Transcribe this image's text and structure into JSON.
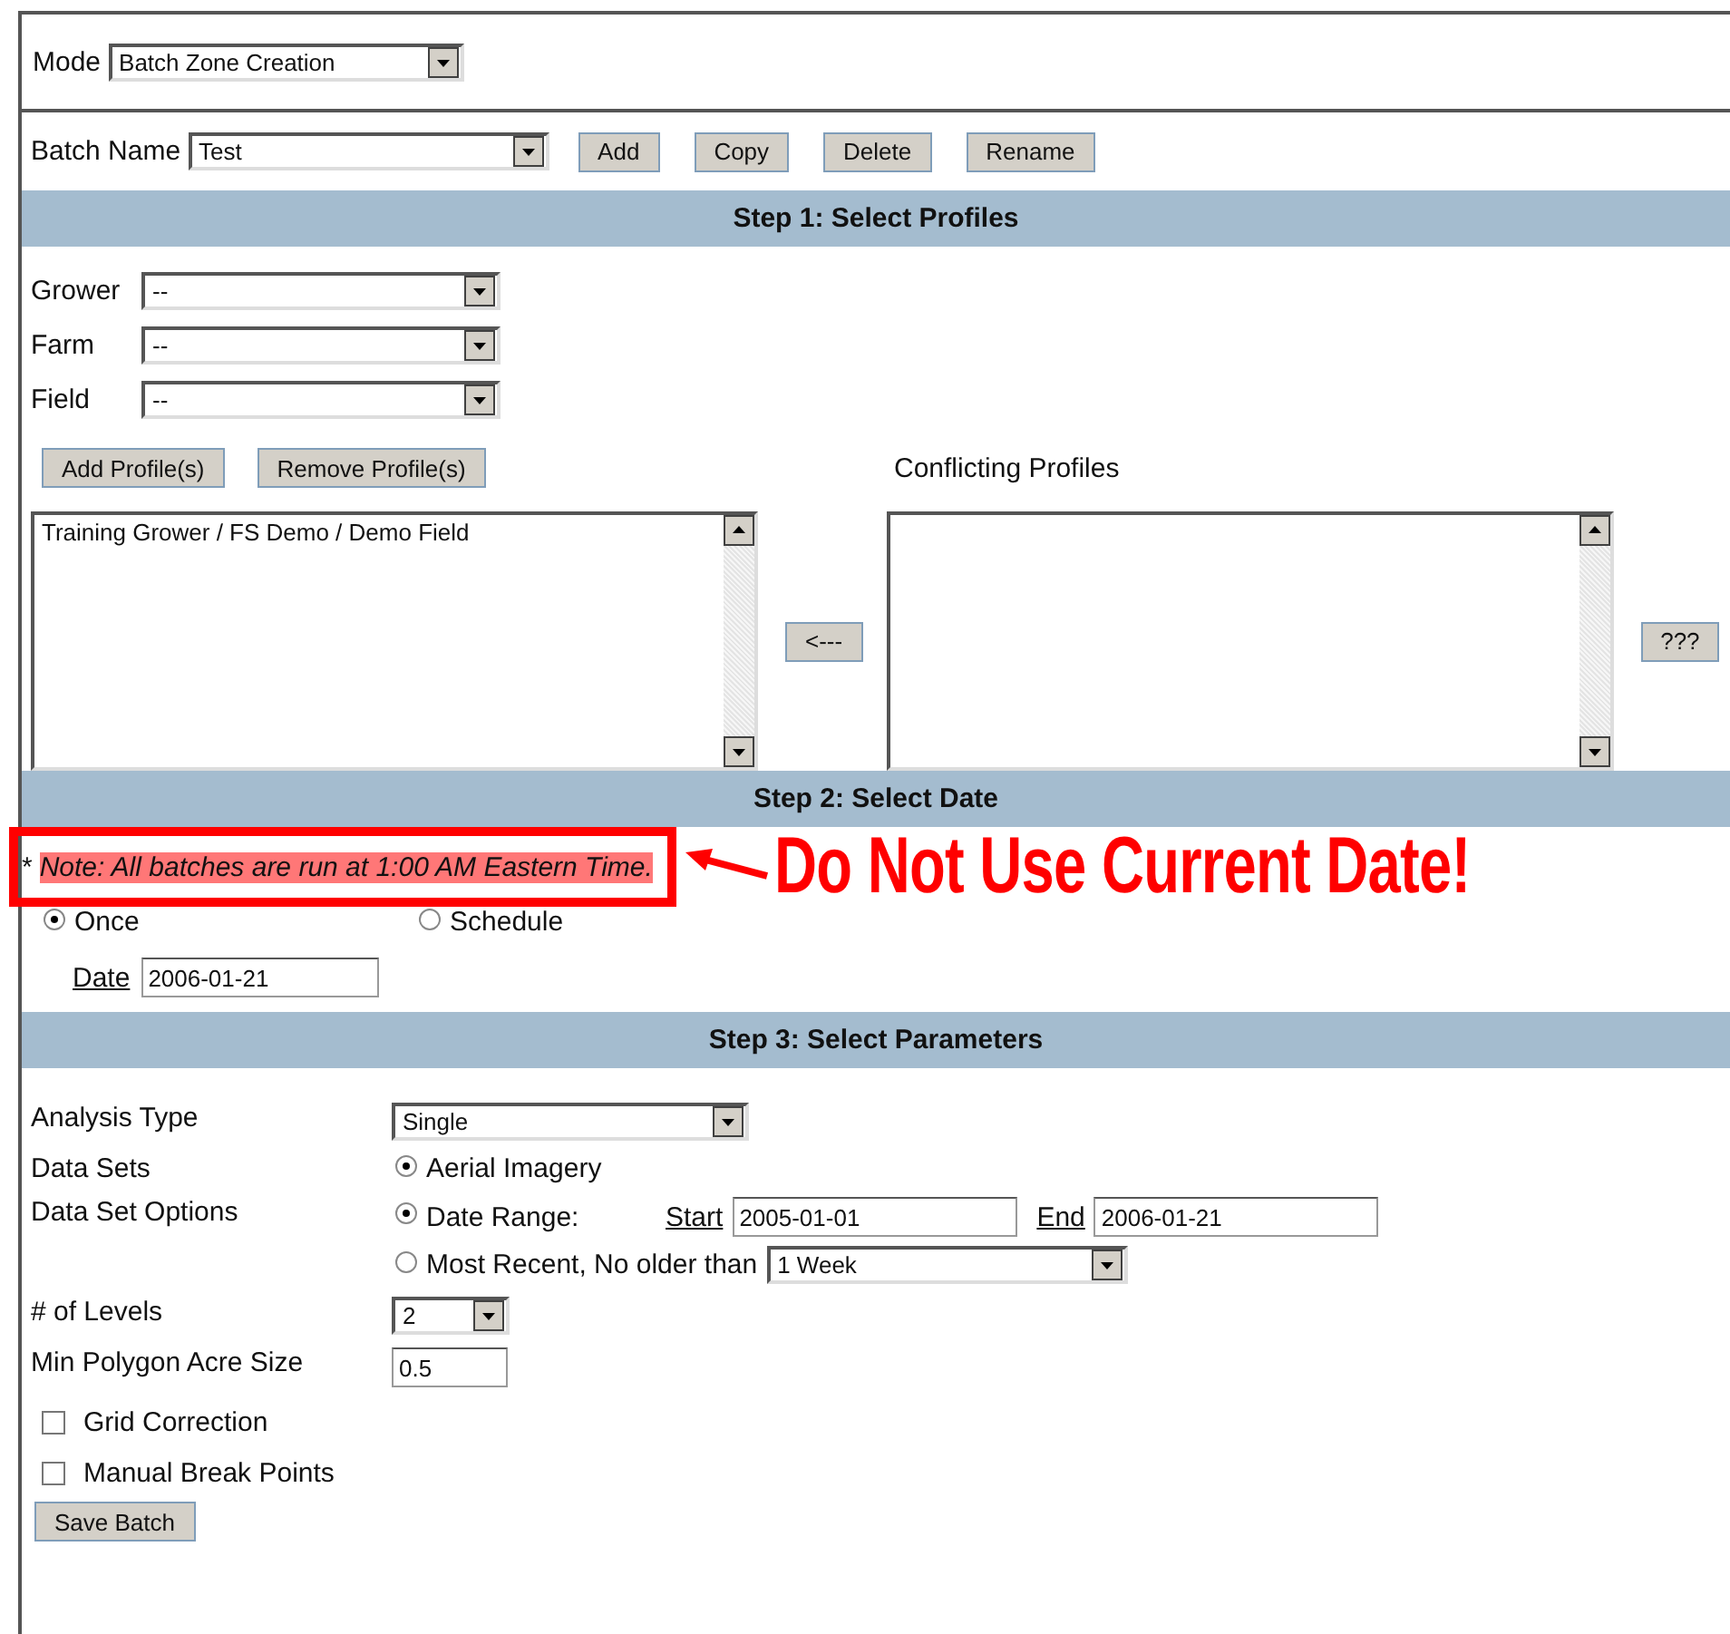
{
  "mode": {
    "label": "Mode",
    "value": "Batch Zone Creation"
  },
  "batch": {
    "label": "Batch Name",
    "value": "Test",
    "buttons": [
      "Add",
      "Copy",
      "Delete",
      "Rename"
    ]
  },
  "step1": {
    "title": "Step 1: Select Profiles",
    "selectors": [
      {
        "label": "Grower",
        "value": "--"
      },
      {
        "label": "Farm",
        "value": "--"
      },
      {
        "label": "Field",
        "value": "--"
      }
    ],
    "buttons": [
      "Add Profile(s)",
      "Remove Profile(s)"
    ],
    "conflicting_title": "Conflicting Profiles",
    "profiles": [
      "Training Grower / FS Demo / Demo Field"
    ],
    "move_button": "<---",
    "conflict_button": "???"
  },
  "step2": {
    "title": "Step 2: Select Date",
    "note_mark": "*",
    "note": "Note: All batches are run at 1:00 AM Eastern Time.",
    "annotation": "Do Not Use Current Date!",
    "frequency": [
      {
        "label": "Once",
        "selected": true
      },
      {
        "label": "Schedule",
        "selected": false
      }
    ],
    "date": {
      "label": "Date",
      "value": "2006-01-21"
    }
  },
  "step3": {
    "title": "Step 3: Select Parameters",
    "analysis_type": {
      "label": "Analysis Type",
      "value": "Single"
    },
    "data_sets": {
      "label": "Data Sets",
      "options": [
        {
          "label": "Aerial Imagery",
          "selected": true
        }
      ]
    },
    "data_set_options": {
      "label": "Data Set Options",
      "options": [
        {
          "kind": "range",
          "label": "Date Range:",
          "selected": true,
          "start_label": "Start",
          "start": "2005-01-01",
          "end_label": "End",
          "end": "2006-01-21"
        },
        {
          "kind": "recent",
          "label": "Most Recent, No older than",
          "selected": false,
          "value": "1 Week"
        }
      ]
    },
    "levels": {
      "label": "# of Levels",
      "value": "2"
    },
    "min_polygon": {
      "label": "Min Polygon Acre Size",
      "value": "0.5"
    },
    "checkboxes": [
      {
        "label": "Grid Correction",
        "checked": false
      },
      {
        "label": "Manual Break Points",
        "checked": false
      }
    ],
    "save_button": "Save Batch"
  }
}
